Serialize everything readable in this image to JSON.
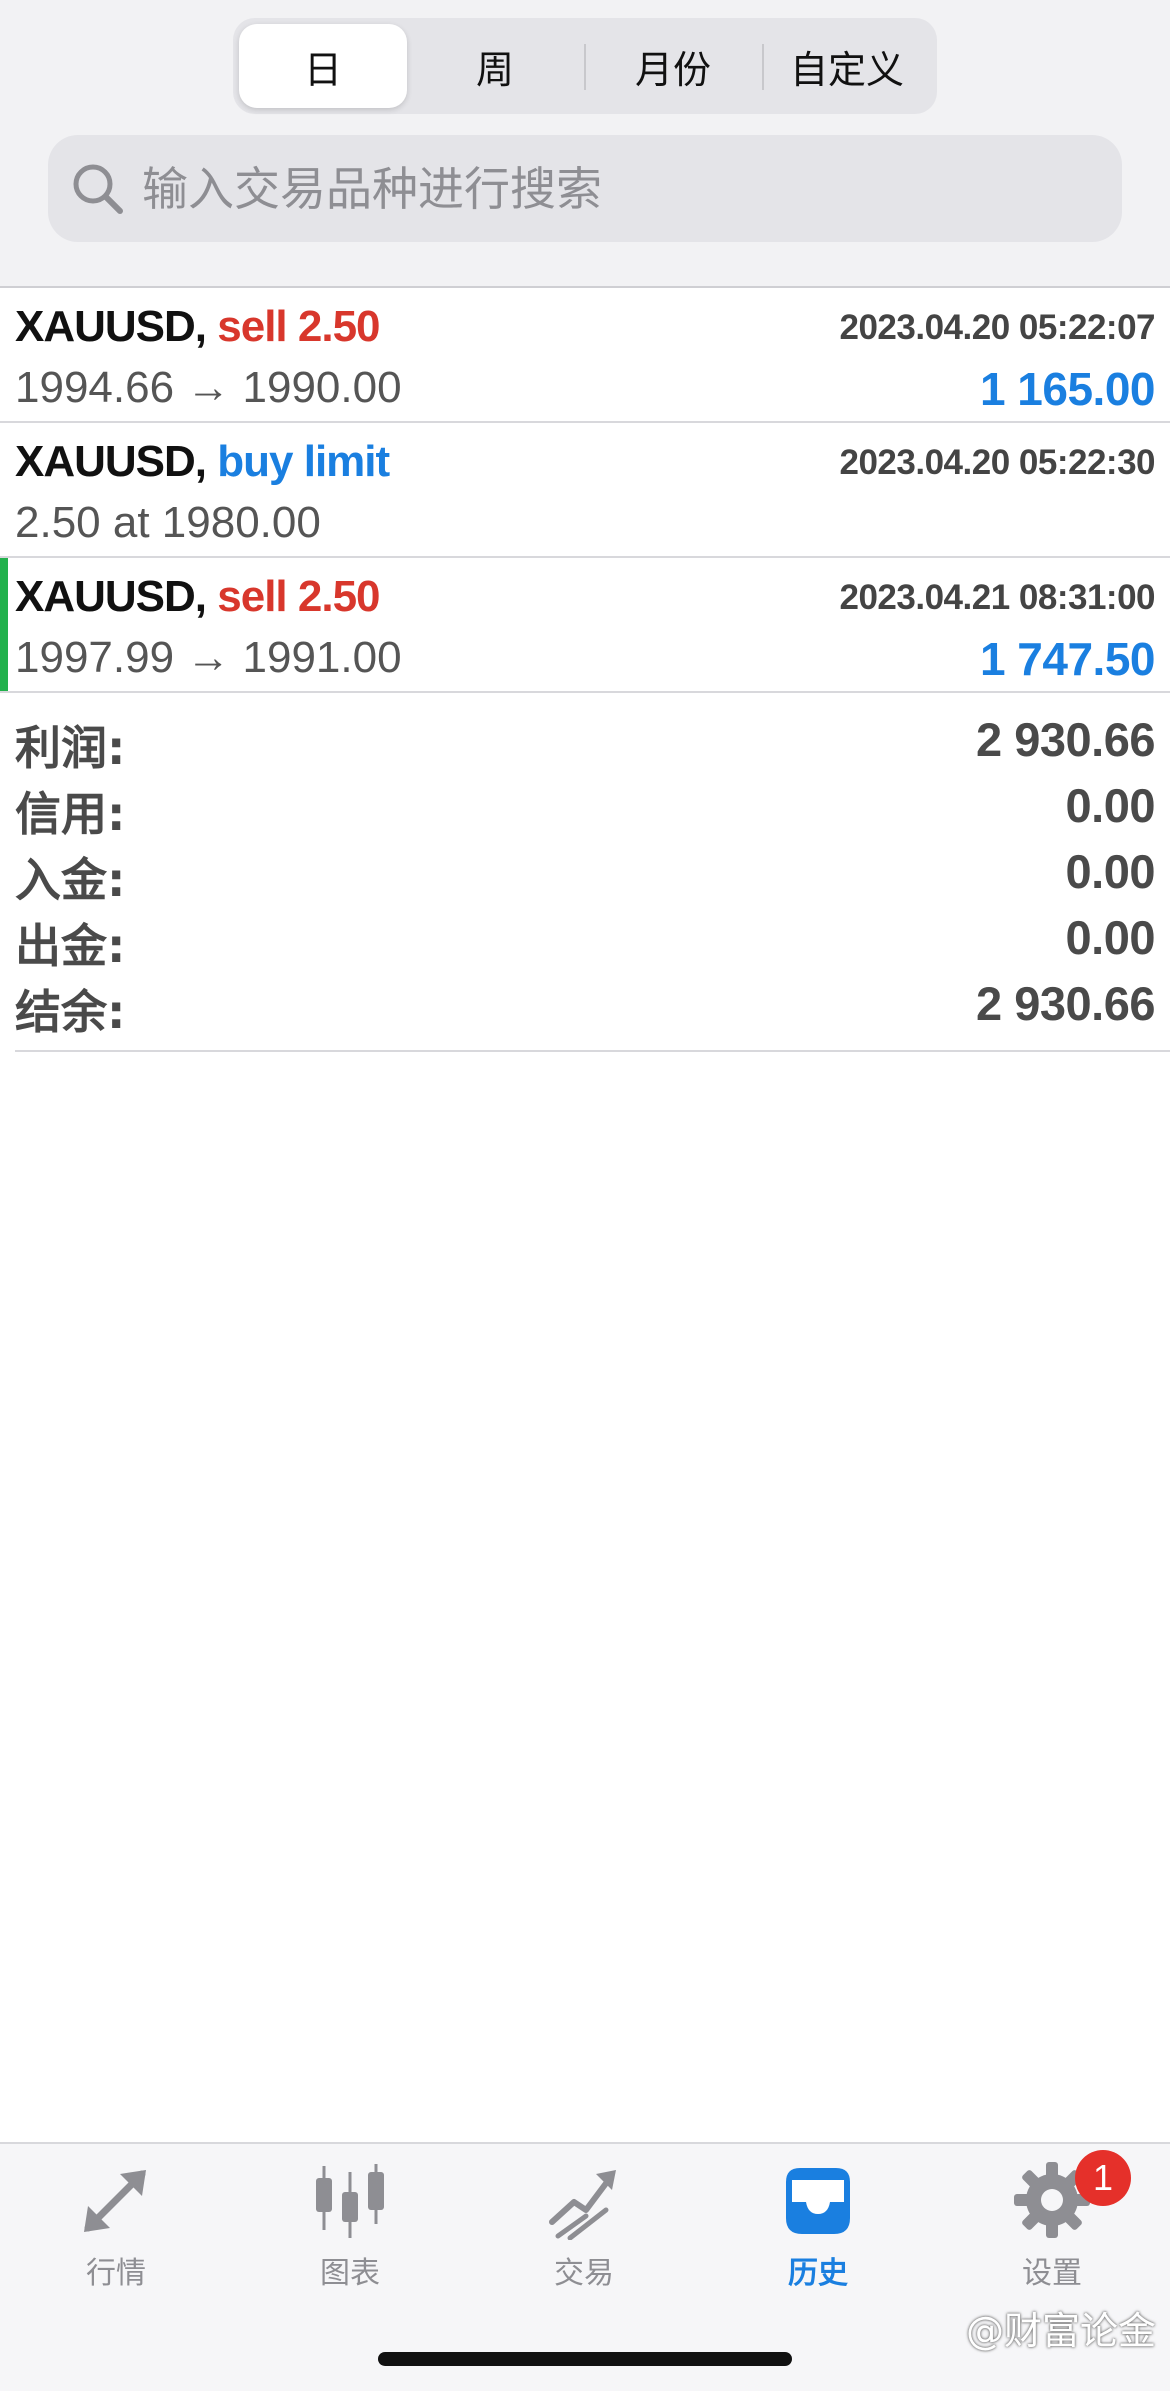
{
  "period_tabs": [
    {
      "label": "日",
      "active": true
    },
    {
      "label": "周",
      "active": false
    },
    {
      "label": "月份",
      "active": false
    },
    {
      "label": "自定义",
      "active": false
    }
  ],
  "search": {
    "placeholder": "输入交易品种进行搜索",
    "icon": "search-icon"
  },
  "deals": [
    {
      "symbol": "XAUUSD,",
      "action": "sell 2.50",
      "action_color": "#d8372c",
      "time": "2023.04.20 05:22:07",
      "detail": "1994.66 → 1990.00",
      "profit": "1 165.00"
    },
    {
      "symbol": "XAUUSD,",
      "action": "buy limit",
      "action_color": "#1a7fe0",
      "time": "2023.04.20 05:22:30",
      "detail": "2.50 at 1980.00",
      "profit": ""
    },
    {
      "symbol": "XAUUSD,",
      "action": "sell 2.50",
      "action_color": "#d8372c",
      "time": "2023.04.21 08:31:00",
      "detail": "1997.99 → 1991.00",
      "profit": "1 747.50",
      "selected": true
    }
  ],
  "summary": [
    {
      "label": "利润:",
      "value": "2 930.66"
    },
    {
      "label": "信用:",
      "value": "0.00"
    },
    {
      "label": "入金:",
      "value": "0.00"
    },
    {
      "label": "出金:",
      "value": "0.00"
    },
    {
      "label": "结余:",
      "value": "2 930.66"
    }
  ],
  "tabbar": [
    {
      "label": "行情",
      "icon": "quotes-arrows-icon",
      "active": false
    },
    {
      "label": "图表",
      "icon": "candlestick-chart-icon",
      "active": false
    },
    {
      "label": "交易",
      "icon": "trade-trend-icon",
      "active": false
    },
    {
      "label": "历史",
      "icon": "history-inbox-icon",
      "active": true
    },
    {
      "label": "设置",
      "icon": "settings-gear-icon",
      "active": false
    }
  ],
  "settings_badge": "1",
  "watermark": "@财富论金",
  "colors": {
    "accent_blue": "#1a7fe0",
    "sell_red": "#d8372c",
    "marker_green": "#22b14c",
    "badge_red": "#e5302a"
  }
}
